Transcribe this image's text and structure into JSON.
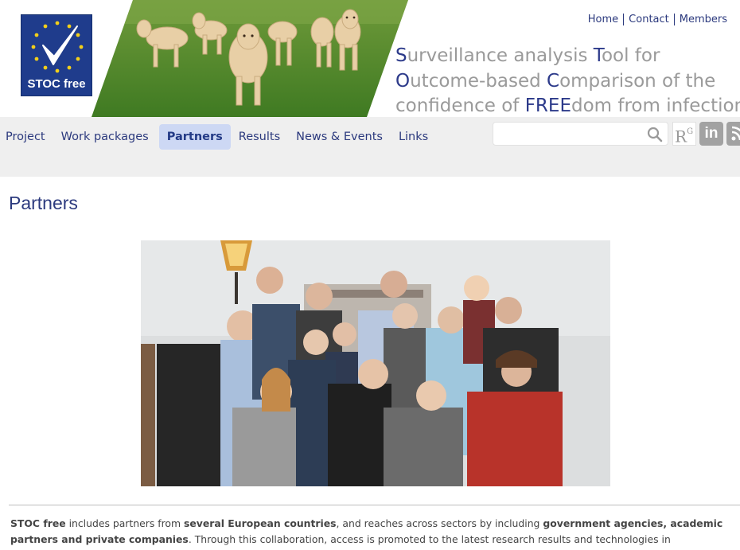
{
  "logo": {
    "text": "STOC free",
    "colors": {
      "background": "#1f3c8c",
      "stars": "#f2cf1a"
    }
  },
  "top_links": [
    "Home",
    "Contact",
    "Members"
  ],
  "tagline": [
    [
      {
        "t": "S",
        "hl": true
      },
      {
        "t": "urveillance analysis ",
        "hl": false
      },
      {
        "t": "T",
        "hl": true
      },
      {
        "t": "ool for",
        "hl": false
      }
    ],
    [
      {
        "t": "O",
        "hl": true
      },
      {
        "t": "utcome-based ",
        "hl": false
      },
      {
        "t": "C",
        "hl": true
      },
      {
        "t": "omparison of the",
        "hl": false
      }
    ],
    [
      {
        "t": "confidence of ",
        "hl": false
      },
      {
        "t": "FREE",
        "hl": true
      },
      {
        "t": "dom from infection",
        "hl": false
      }
    ]
  ],
  "nav": {
    "items": [
      "Project",
      "Work packages",
      "Partners",
      "Results",
      "News & Events",
      "Links"
    ],
    "active": "Partners"
  },
  "search": {
    "placeholder": "",
    "value": ""
  },
  "social": {
    "researchgate": "R",
    "researchgate_sup": "G",
    "linkedin": "in"
  },
  "page": {
    "title": "Partners"
  },
  "intro": [
    {
      "t": "STOC free",
      "b": true
    },
    {
      "t": " includes partners from ",
      "b": false
    },
    {
      "t": "several European countries",
      "b": true
    },
    {
      "t": ", and reaches across sectors by including ",
      "b": false
    },
    {
      "t": "government agencies, academic partners and private companies",
      "b": true
    },
    {
      "t": ". Through this collaboration, access is promoted to the latest research results and technologies in surveillance.",
      "b": false
    }
  ],
  "colors": {
    "accent": "#2c3a7e",
    "nav_bg": "#efefef",
    "nav_active_bg": "#cdd8f4",
    "tagline_grey": "#9a9a9a"
  }
}
